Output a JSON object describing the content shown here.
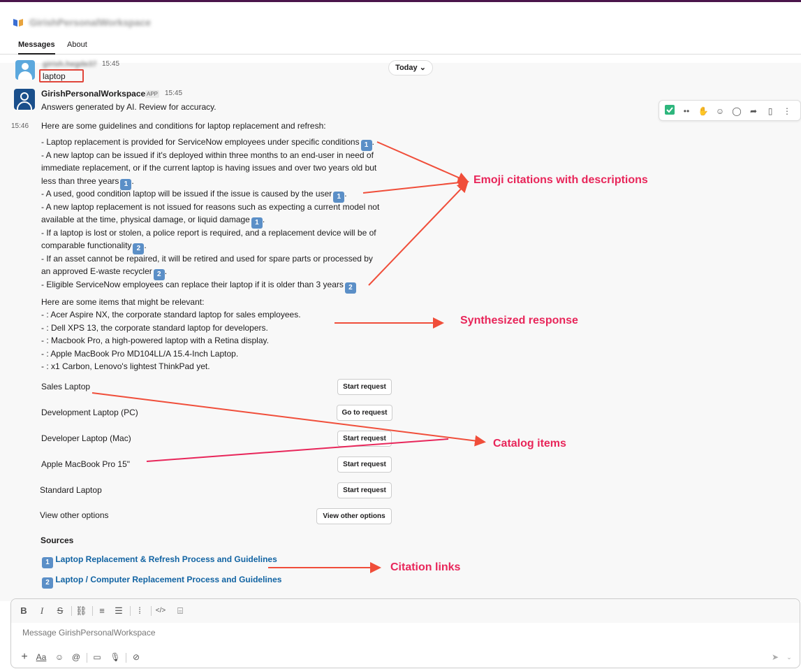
{
  "workspace": {
    "name": "GirishPersonalWorkspace"
  },
  "tabs": [
    {
      "label": "Messages"
    },
    {
      "label": "About"
    }
  ],
  "user_message": {
    "name": "girish.hegde37",
    "time": "15:45",
    "text": "laptop"
  },
  "today_pill": "Today ⌄",
  "app_message": {
    "name": "GirishPersonalWorkspace",
    "badge": "APP",
    "time": "15:45",
    "disclaimer": "Answers generated by AI. Review for accuracy.",
    "timestamp_small": "15:46",
    "intro": "Here are some guidelines and conditions for laptop replacement and refresh:",
    "guidelines": [
      "- Laptop replacement is provided for ServiceNow employees under specific conditions",
      "- A new laptop can be issued if it's deployed within three months to an end-user in need of",
      "immediate replacement, or if the current laptop is having issues and over two years old but",
      "less than three years",
      "- A used, good condition laptop will be issued if the issue is caused by the user",
      "- A new laptop replacement is not issued for reasons such as expecting a current model not",
      "available at the time, physical damage, or liquid damage",
      "- If a laptop is lost or stolen, a police report is required, and a replacement device will be of",
      "comparable functionality",
      "- If an asset cannot be repaired, it will be retired and used for spare parts or processed by",
      "an approved E-waste recycler",
      "- Eligible ServiceNow employees can replace their laptop if it is older than 3 years"
    ],
    "citation_numbers": [
      "1",
      "1",
      "1",
      "1",
      "2",
      "2",
      "2"
    ],
    "items_intro": "Here are some items that might be relevant:",
    "items": [
      "- : Acer Aspire NX, the corporate standard laptop for sales employees.",
      "- : Dell XPS 13, the corporate standard laptop for developers.",
      "- : Macbook Pro, a high-powered laptop with a Retina display.",
      "- : Apple MacBook Pro MD104LL/A 15.4-Inch Laptop.",
      "- : x1 Carbon, Lenovo's lightest ThinkPad yet."
    ],
    "catalog": [
      {
        "label": "Sales Laptop",
        "button": "Start request"
      },
      {
        "label": "Development Laptop (PC)",
        "button": "Go to request"
      },
      {
        "label": "Developer Laptop (Mac)",
        "button": "Start request"
      },
      {
        "label": "Apple MacBook Pro 15\"",
        "button": "Start request"
      },
      {
        "label": "Standard Laptop",
        "button": "Start request"
      },
      {
        "label": "View other options",
        "button": "View other options"
      }
    ],
    "sources_title": "Sources",
    "sources": [
      {
        "num": "1",
        "title": "Laptop Replacement & Refresh Process and Guidelines"
      },
      {
        "num": "2",
        "title": "Laptop / Computer Replacement Process and Guidelines"
      }
    ]
  },
  "annotations": {
    "emoji": "Emoji citations with descriptions",
    "synth": "Synthesized response",
    "catalog": "Catalog items",
    "links": "Citation links"
  },
  "composer": {
    "placeholder": "Message GirishPersonalWorkspace"
  },
  "colors": {
    "accent": "#4a154b",
    "annotation": "#e8265a",
    "link": "#1264a3",
    "citation": "#5b8fc7"
  }
}
